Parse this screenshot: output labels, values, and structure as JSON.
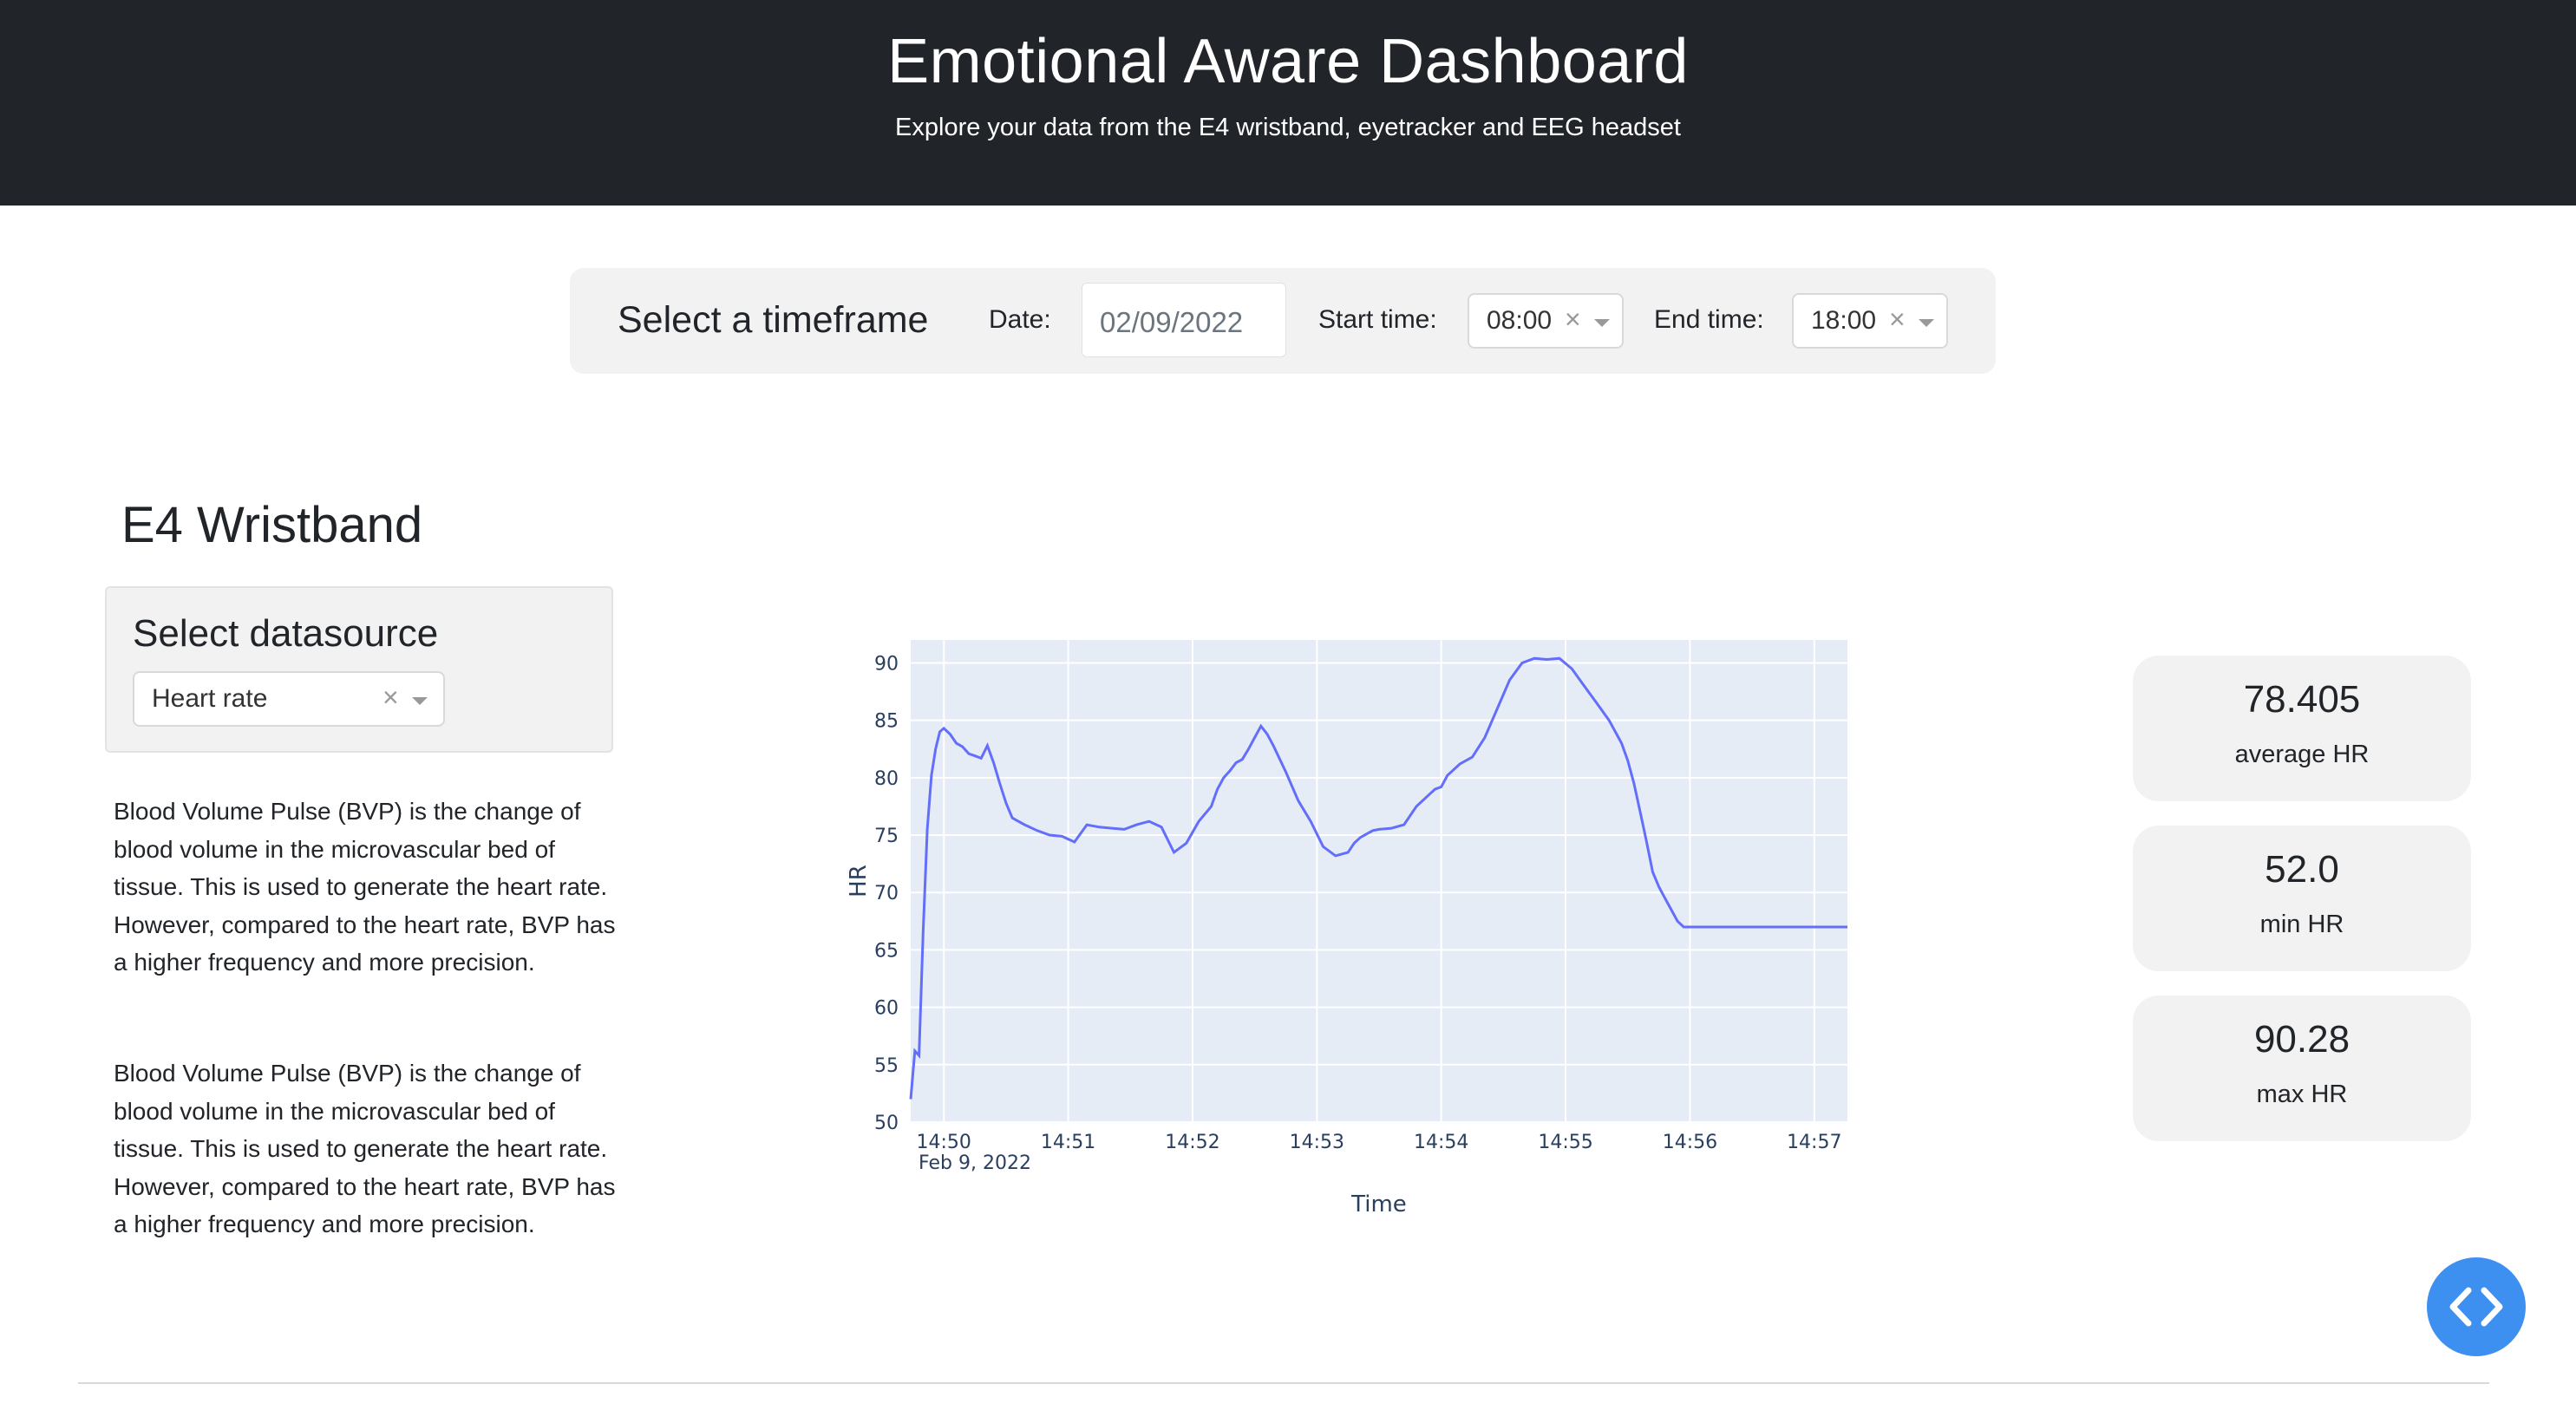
{
  "header": {
    "title": "Emotional Aware Dashboard",
    "subtitle": "Explore your data from the E4 wristband, eyetracker and EEG headset"
  },
  "timeframe": {
    "title": "Select a timeframe",
    "date_label": "Date:",
    "date_value": "02/09/2022",
    "start_label": "Start time:",
    "start_value": "08:00",
    "end_label": "End time:",
    "end_value": "18:00"
  },
  "section": {
    "title": "E4 Wristband"
  },
  "datasource": {
    "title": "Select datasource",
    "selected": "Heart rate"
  },
  "description": {
    "para1": "Blood Volume Pulse (BVP) is the change of blood volume in the microvascular bed of tissue. This is used to generate the heart rate. However, compared to the heart rate, BVP has a higher frequency and more precision.",
    "para2": "Blood Volume Pulse (BVP) is the change of blood volume in the microvascular bed of tissue. This is used to generate the heart rate. However, compared to the heart rate, BVP has a higher frequency and more precision."
  },
  "stats": [
    {
      "value": "78.405",
      "label": "average HR"
    },
    {
      "value": "52.0",
      "label": "min HR"
    },
    {
      "value": "90.28",
      "label": "max HR"
    }
  ],
  "icons": {
    "clear": "close-icon",
    "dropdown": "chevron-down-icon",
    "fab": "code-icon"
  },
  "colors": {
    "header_bg": "#212529",
    "line": "#636efa",
    "plot_bg": "#e5ecf6",
    "fab": "#3d8ff0"
  },
  "chart_data": {
    "type": "line",
    "xlabel": "Time",
    "ylabel": "HR",
    "ylim": [
      50,
      92
    ],
    "xlim": [
      "14:49:44",
      "14:57:16"
    ],
    "x_ticks": [
      "14:50",
      "14:51",
      "14:52",
      "14:53",
      "14:54",
      "14:55",
      "14:56",
      "14:57"
    ],
    "x_sublabel": "Feb 9, 2022",
    "y_ticks": [
      50,
      55,
      60,
      65,
      70,
      75,
      80,
      85,
      90
    ],
    "grid": true,
    "series": [
      {
        "x": [
          "14:49:44",
          "14:49:46",
          "14:49:48",
          "14:49:50",
          "14:49:52",
          "14:49:54",
          "14:49:56",
          "14:49:58",
          "14:50:00",
          "14:50:03",
          "14:50:06",
          "14:50:09",
          "14:50:12",
          "14:50:15",
          "14:50:18",
          "14:50:21",
          "14:50:24",
          "14:50:27",
          "14:50:30",
          "14:50:33",
          "14:50:36",
          "14:50:39",
          "14:50:45",
          "14:50:51",
          "14:50:57",
          "14:51:03",
          "14:51:09",
          "14:51:15",
          "14:51:21",
          "14:51:27",
          "14:51:33",
          "14:51:39",
          "14:51:45",
          "14:51:51",
          "14:51:57",
          "14:52:03",
          "14:52:09",
          "14:52:12",
          "14:52:15",
          "14:52:18",
          "14:52:21",
          "14:52:24",
          "14:52:27",
          "14:52:30",
          "14:52:33",
          "14:52:36",
          "14:52:39",
          "14:52:45",
          "14:52:51",
          "14:52:57",
          "14:53:03",
          "14:53:09",
          "14:53:15",
          "14:53:18",
          "14:53:21",
          "14:53:24",
          "14:53:27",
          "14:53:30",
          "14:53:36",
          "14:53:42",
          "14:53:48",
          "14:53:54",
          "14:53:57",
          "14:54:00",
          "14:54:03",
          "14:54:09",
          "14:54:15",
          "14:54:21",
          "14:54:27",
          "14:54:33",
          "14:54:39",
          "14:54:45",
          "14:54:51",
          "14:54:57",
          "14:55:03",
          "14:55:09",
          "14:55:15",
          "14:55:21",
          "14:55:27",
          "14:55:30",
          "14:55:33",
          "14:55:36",
          "14:55:39",
          "14:55:42",
          "14:55:45",
          "14:55:48",
          "14:55:51",
          "14:55:54",
          "14:55:57",
          "14:56:00",
          "14:56:03",
          "14:56:06",
          "14:56:09",
          "14:56:12",
          "14:56:15",
          "14:56:18",
          "14:56:21",
          "14:56:24",
          "14:56:27",
          "14:56:30",
          "14:56:33",
          "14:56:36",
          "14:56:39",
          "14:56:42",
          "14:56:45",
          "14:56:48",
          "14:56:51",
          "14:56:54",
          "14:56:57",
          "14:57:00",
          "14:57:03",
          "14:57:06",
          "14:57:09",
          "14:57:12",
          "14:57:16"
        ],
        "values": [
          52.0,
          56.2,
          55.8,
          66.5,
          75.5,
          80.2,
          82.5,
          84.0,
          84.3,
          83.8,
          83.0,
          82.7,
          82.1,
          81.9,
          81.7,
          82.8,
          81.3,
          79.5,
          77.8,
          76.5,
          76.2,
          75.9,
          75.4,
          75.0,
          74.9,
          74.4,
          75.9,
          75.7,
          75.6,
          75.5,
          75.9,
          76.2,
          75.7,
          73.5,
          74.3,
          76.2,
          77.5,
          79.0,
          80.0,
          80.6,
          81.3,
          81.6,
          82.5,
          83.5,
          84.5,
          83.8,
          82.8,
          80.5,
          78.0,
          76.2,
          74.0,
          73.2,
          73.5,
          74.3,
          74.8,
          75.1,
          75.4,
          75.5,
          75.6,
          75.9,
          77.5,
          78.5,
          79.0,
          79.2,
          80.2,
          81.2,
          81.8,
          83.5,
          86.0,
          88.5,
          90.0,
          90.4,
          90.3,
          90.4,
          89.5,
          88.0,
          86.5,
          85.0,
          83.0,
          81.5,
          79.5,
          77.0,
          74.5,
          71.8,
          70.5,
          69.5,
          68.5,
          67.5,
          67.0,
          67.0,
          67.0,
          67.0,
          67.0,
          67.0,
          67.0,
          67.0,
          67.0,
          67.0,
          67.0,
          67.0,
          67.0,
          67.0,
          67.0,
          67.0,
          67.0,
          67.0,
          67.0,
          67.0,
          67.0,
          67.0,
          67.0,
          67.0,
          67.0,
          67.0,
          67.0
        ]
      }
    ]
  }
}
